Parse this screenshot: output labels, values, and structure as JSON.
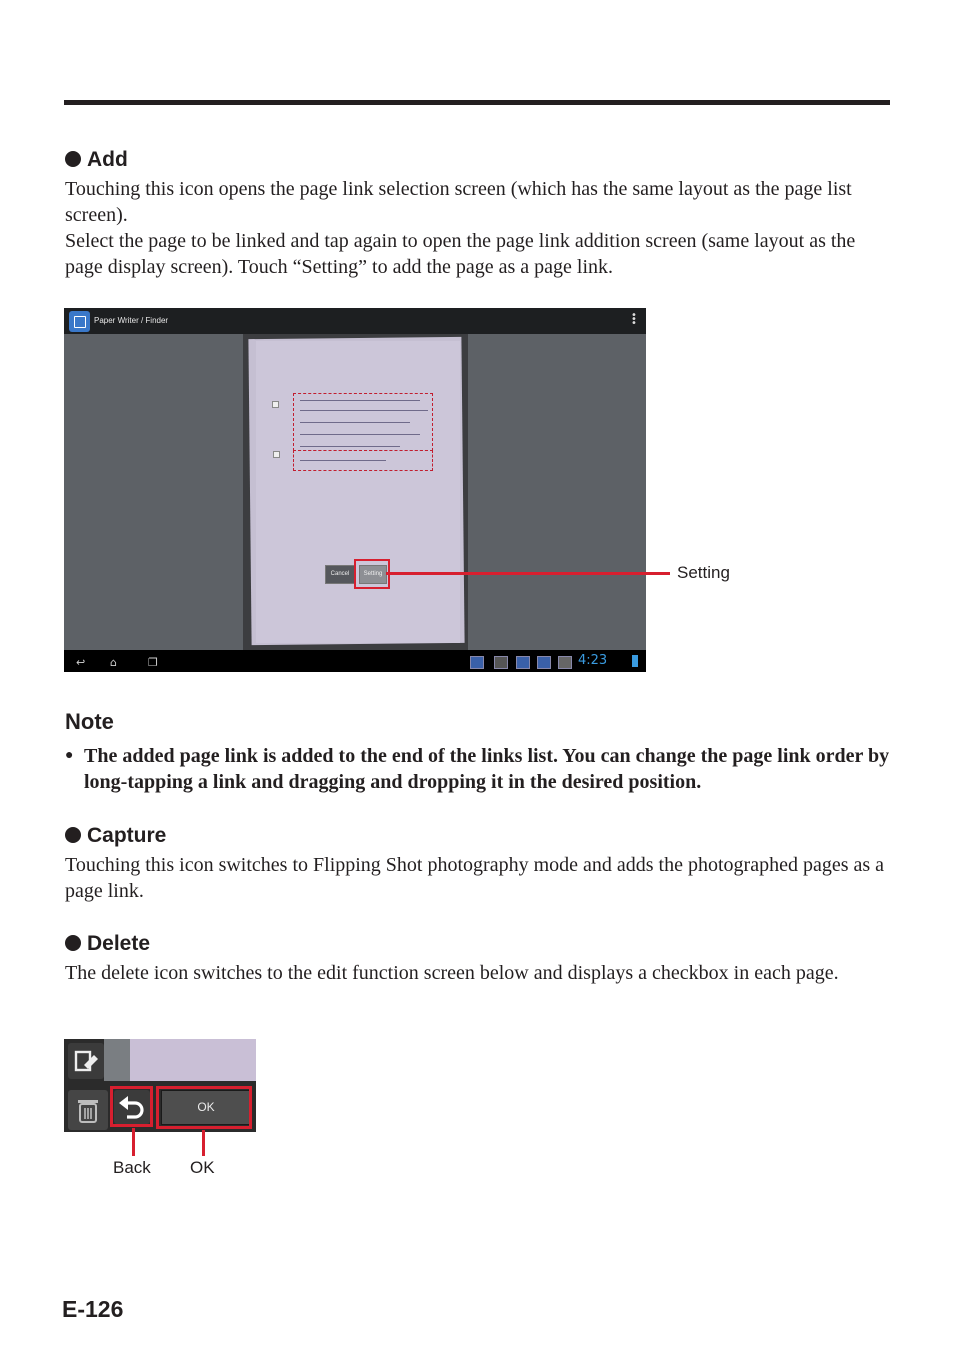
{
  "sections": {
    "add": {
      "title": "Add",
      "p1": "Touching this icon opens the page link selection screen (which has the same layout as the page list screen).",
      "p2": "Select the page to be linked and tap again to open the page link addition screen (same layout as the page display screen). Touch “Setting” to add the page as a page link."
    },
    "capture": {
      "title": "Capture",
      "p1": "Touching this icon switches to Flipping Shot photography mode and adds the photographed pages as a page link."
    },
    "delete": {
      "title": "Delete",
      "p1": "The delete icon switches to the edit function screen below and displays a checkbox in each page."
    }
  },
  "note": {
    "title": "Note",
    "bullet": "●",
    "item": "The added page link is added to the end of the links list. You can change the page link order by long-tapping a link and dragging and dropping it in the desired position."
  },
  "screenshot1": {
    "app_title": "Paper Writer / Finder",
    "cancel_label": "Cancel",
    "setting_label": "Setting",
    "clock": "4:23",
    "icons": [
      "app-icon",
      "overflow-menu-icon",
      "back-icon",
      "home-icon",
      "recent-apps-icon"
    ]
  },
  "callouts": {
    "setting": "Setting",
    "back": "Back",
    "ok": "OK"
  },
  "screenshot2": {
    "ok_label": "OK",
    "icons": [
      "page-edit-icon",
      "trash-icon",
      "undo-icon"
    ]
  },
  "page_number": "E-126",
  "colors": {
    "callout_red": "#d71f2f",
    "ink": "#231f20",
    "clock_blue": "#3a9be0"
  }
}
